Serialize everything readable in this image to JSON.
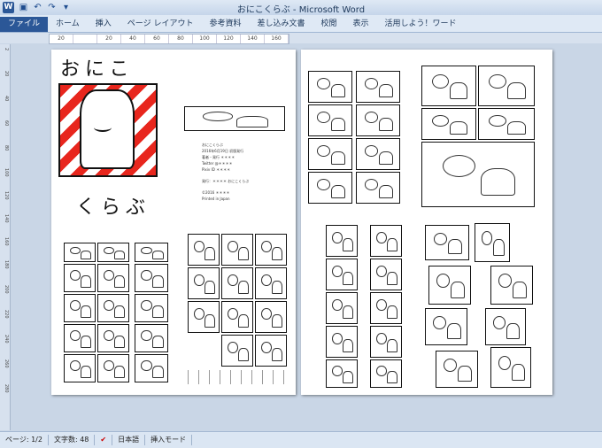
{
  "window": {
    "title": "おにこくらぶ - Microsoft Word"
  },
  "qat": {
    "icons": [
      "save-icon",
      "undo-icon",
      "redo-icon",
      "customize-icon"
    ]
  },
  "ribbon": {
    "tabs": [
      "ファイル",
      "ホーム",
      "挿入",
      "ページ レイアウト",
      "参考資料",
      "差し込み文書",
      "校閲",
      "表示",
      "活用しよう！ワード"
    ]
  },
  "ruler": {
    "ticks": [
      "20",
      "",
      "20",
      "40",
      "60",
      "80",
      "100",
      "120",
      "140",
      "160"
    ]
  },
  "vruler": {
    "ticks": [
      "2",
      "20",
      "40",
      "60",
      "80",
      "100",
      "120",
      "140",
      "160",
      "180",
      "200",
      "220",
      "240",
      "260",
      "280"
    ]
  },
  "cover": {
    "top": "おにこ",
    "bottom": "くらぶ"
  },
  "colophon": {
    "lines": [
      "おにこくらぶ",
      "2016年6月19日 初版発行",
      "著者・発行 ＊＊＊＊",
      "Twitter @＊＊＊＊",
      "Pixiv ID ＊＊＊＊",
      "発行：＊＊＊＊ おにこくらぶ",
      "©2016 ＊＊＊＊",
      "Printed in Japan"
    ]
  },
  "status": {
    "page": "ページ: 1/2",
    "words": "文字数: 48",
    "language": "日本語",
    "mode": "挿入モード"
  },
  "colors": {
    "accent": "#2b5797",
    "cover_red": "#e8261d"
  }
}
